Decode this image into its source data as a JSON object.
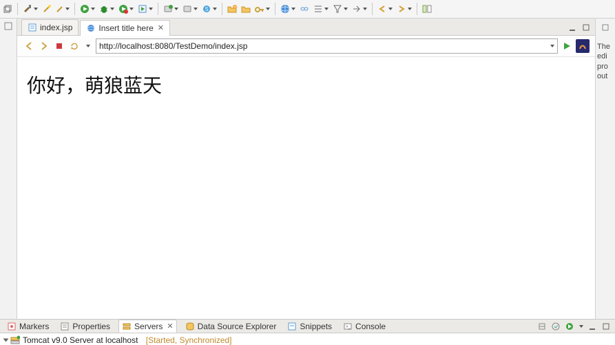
{
  "tabs": {
    "file": {
      "label": "index.jsp"
    },
    "browser": {
      "label": "Insert title here"
    }
  },
  "url": "http://localhost:8080/TestDemo/index.jsp",
  "page_text": "你好，萌狼蓝天",
  "right_panel_text": "The edi pro out",
  "bottom": {
    "markers": "Markers",
    "properties": "Properties",
    "servers": "Servers",
    "data_explorer": "Data Source Explorer",
    "snippets": "Snippets",
    "console": "Console"
  },
  "server": {
    "name": "Tomcat v9.0 Server at localhost",
    "status": "[Started, Synchronized]"
  }
}
